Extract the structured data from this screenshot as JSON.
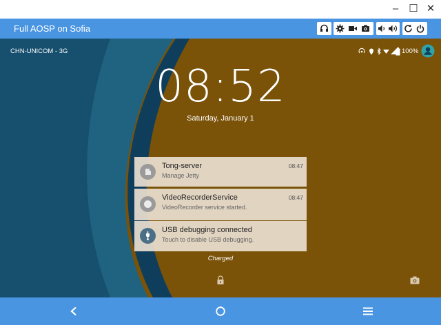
{
  "window": {
    "title": "Full AOSP on Sofia",
    "controls": [
      "minimize",
      "maximize",
      "close"
    ]
  },
  "toolbar": {
    "buttons": [
      "headset-icon",
      "settings-icon",
      "video-camera-icon",
      "camera-icon",
      "volume-down-icon",
      "volume-up-icon",
      "rotate-icon",
      "power-icon"
    ]
  },
  "statusbar": {
    "carrier": "CHN-UNICOM - 3G",
    "battery": "100%"
  },
  "lockscreen": {
    "time": "08:52",
    "date": "Saturday, January 1",
    "charge_status": "Charged"
  },
  "notifications": [
    {
      "title": "Tong-server",
      "subtitle": "Manage Jetty",
      "time": "08:47",
      "icon": "tong-server-icon"
    },
    {
      "title": "VideoRecorderService",
      "subtitle": "VideoRecorder service started.",
      "time": "08:47",
      "icon": "circle-icon"
    },
    {
      "title": "USB debugging connected",
      "subtitle": "Touch to disable USB debugging.",
      "time": "",
      "icon": "usb-icon"
    }
  ],
  "navigation": [
    "back-icon",
    "home-icon",
    "menu-icon"
  ],
  "colors": {
    "header": "#4a95e1",
    "wallpaper_dark_blue": "#0f3e5c",
    "wallpaper_teal": "#1f6380",
    "wallpaper_brown": "#7a5208",
    "notification_bg": "#e8ded0"
  }
}
